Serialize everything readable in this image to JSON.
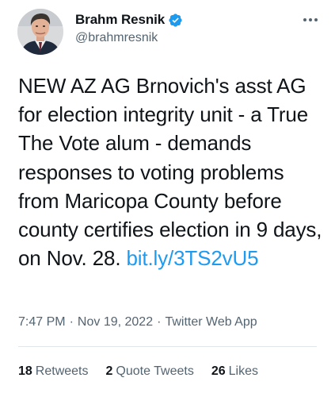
{
  "author": {
    "display_name": "Brahm Resnik",
    "handle": "@brahmresnik",
    "verified": true,
    "verified_color": "#1d9bf0"
  },
  "tweet": {
    "text": "NEW AZ AG Brnovich's asst AG for election integrity unit - a True The Vote alum - demands responses to voting problems from Maricopa County before county certifies election in 9 days, on Nov. 28. ",
    "link": "bit.ly/3TS2vU5",
    "link_color": "#1d9bf0"
  },
  "meta": {
    "time": "7:47 PM",
    "separator": "·",
    "date": "Nov 19, 2022",
    "app": "Twitter Web App"
  },
  "stats": {
    "retweets_count": "18",
    "retweets_label": "Retweets",
    "quotes_count": "2",
    "quotes_label": "Quote Tweets",
    "likes_count": "26",
    "likes_label": "Likes"
  },
  "icons": {
    "more": "more-horizontal-icon",
    "verified": "verified-badge-icon"
  }
}
